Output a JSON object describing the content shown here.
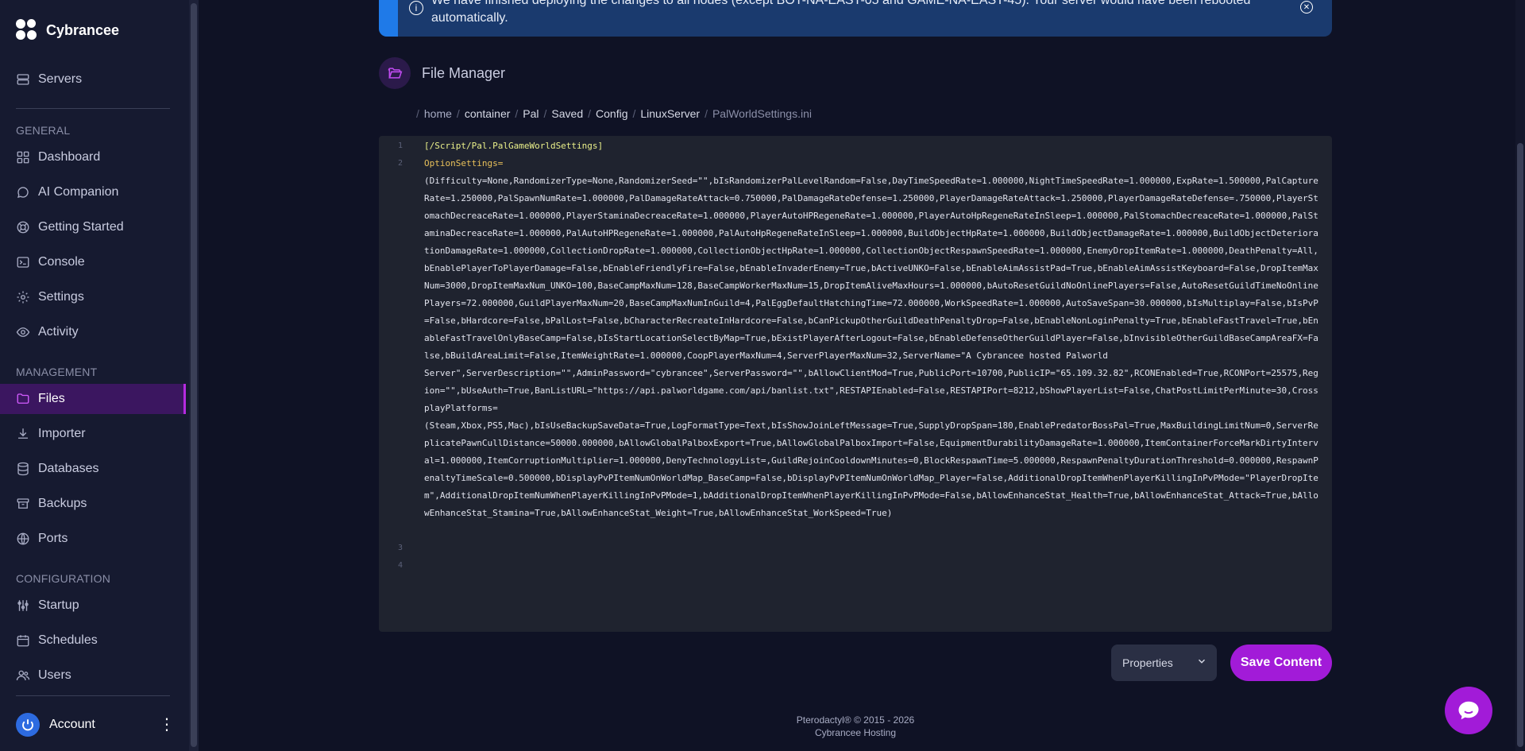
{
  "brand": {
    "name": "Cybrancee"
  },
  "sidebar": {
    "top_item": "Servers",
    "sections": {
      "general": "GENERAL",
      "management": "MANAGEMENT",
      "configuration": "CONFIGURATION"
    },
    "items": {
      "dashboard": "Dashboard",
      "ai_companion": "AI Companion",
      "getting_started": "Getting Started",
      "console": "Console",
      "settings": "Settings",
      "activity": "Activity",
      "files": "Files",
      "importer": "Importer",
      "databases": "Databases",
      "backups": "Backups",
      "ports": "Ports",
      "startup": "Startup",
      "schedules": "Schedules",
      "users": "Users"
    },
    "account": "Account"
  },
  "alert": {
    "text": "We have finished deploying the changes to all nodes (except BOT-NA-EAST-05 and GAME-NA-EAST-45). Your server would have been rebooted automatically."
  },
  "file_manager": {
    "title": "File Manager"
  },
  "breadcrumb": {
    "segments": [
      "home",
      "container",
      "Pal",
      "Saved",
      "Config",
      "LinuxServer"
    ],
    "file": "PalWorldSettings.ini"
  },
  "editor": {
    "line_numbers": [
      "1",
      "2",
      "3",
      "4"
    ],
    "line1": "[/Script/Pal.PalGameWorldSettings]",
    "line2": "OptionSettings=",
    "content": "(Difficulty=None,RandomizerType=None,RandomizerSeed=\"\",bIsRandomizerPalLevelRandom=False,DayTimeSpeedRate=1.000000,NightTimeSpeedRate=1.000000,ExpRate=1.500000,PalCaptureRate=1.250000,PalSpawnNumRate=1.000000,PalDamageRateAttack=0.750000,PalDamageRateDefense=1.250000,PlayerDamageRateAttack=1.250000,PlayerDamageRateDefense=.750000,PlayerStomachDecreaceRate=1.000000,PlayerStaminaDecreaceRate=1.000000,PlayerAutoHPRegeneRate=1.000000,PlayerAutoHpRegeneRateInSleep=1.000000,PalStomachDecreaceRate=1.000000,PalStaminaDecreaceRate=1.000000,PalAutoHPRegeneRate=1.000000,PalAutoHpRegeneRateInSleep=1.000000,BuildObjectHpRate=1.000000,BuildObjectDamageRate=1.000000,BuildObjectDeteriorationDamageRate=1.000000,CollectionDropRate=1.000000,CollectionObjectHpRate=1.000000,CollectionObjectRespawnSpeedRate=1.000000,EnemyDropItemRate=1.000000,DeathPenalty=All,bEnablePlayerToPlayerDamage=False,bEnableFriendlyFire=False,bEnableInvaderEnemy=True,bActiveUNKO=False,bEnableAimAssistPad=True,bEnableAimAssistKeyboard=False,DropItemMaxNum=3000,DropItemMaxNum_UNKO=100,BaseCampMaxNum=128,BaseCampWorkerMaxNum=15,DropItemAliveMaxHours=1.000000,bAutoResetGuildNoOnlinePlayers=False,AutoResetGuildTimeNoOnlinePlayers=72.000000,GuildPlayerMaxNum=20,BaseCampMaxNumInGuild=4,PalEggDefaultHatchingTime=72.000000,WorkSpeedRate=1.000000,AutoSaveSpan=30.000000,bIsMultiplay=False,bIsPvP=False,bHardcore=False,bPalLost=False,bCharacterRecreateInHardcore=False,bCanPickupOtherGuildDeathPenaltyDrop=False,bEnableNonLoginPenalty=True,bEnableFastTravel=True,bEnableFastTravelOnlyBaseCamp=False,bIsStartLocationSelectByMap=True,bExistPlayerAfterLogout=False,bEnableDefenseOtherGuildPlayer=False,bInvisibleOtherGuildBaseCampAreaFX=False,bBuildAreaLimit=False,ItemWeightRate=1.000000,CoopPlayerMaxNum=4,ServerPlayerMaxNum=32,ServerName=\"A Cybrancee hosted Palworld\nServer\",ServerDescription=\"\",AdminPassword=\"cybrancee\",ServerPassword=\"\",bAllowClientMod=True,PublicPort=10700,PublicIP=\"65.109.32.82\",RCONEnabled=True,RCONPort=25575,Region=\"\",bUseAuth=True,BanListURL=\"https://api.palworldgame.com/api/banlist.txt\",RESTAPIEnabled=False,RESTAPIPort=8212,bShowPlayerList=False,ChatPostLimitPerMinute=30,CrossplayPlatforms=\n(Steam,Xbox,PS5,Mac),bIsUseBackupSaveData=True,LogFormatType=Text,bIsShowJoinLeftMessage=True,SupplyDropSpan=180,EnablePredatorBossPal=True,MaxBuildingLimitNum=0,ServerReplicatePawnCullDistance=50000.000000,bAllowGlobalPalboxExport=True,bAllowGlobalPalboxImport=False,EquipmentDurabilityDamageRate=1.000000,ItemContainerForceMarkDirtyInterval=1.000000,ItemCorruptionMultiplier=1.000000,DenyTechnologyList=,GuildRejoinCooldownMinutes=0,BlockRespawnTime=5.000000,RespawnPenaltyDurationThreshold=0.000000,RespawnPenaltyTimeScale=0.500000,bDisplayPvPItemNumOnWorldMap_BaseCamp=False,bDisplayPvPItemNumOnWorldMap_Player=False,AdditionalDropItemWhenPlayerKillingInPvPMode=\"PlayerDropItem\",AdditionalDropItemNumWhenPlayerKillingInPvPMode=1,bAdditionalDropItemWhenPlayerKillingInPvPMode=False,bAllowEnhanceStat_Health=True,bAllowEnhanceStat_Attack=True,bAllowEnhanceStat_Stamina=True,bAllowEnhanceStat_Weight=True,bAllowEnhanceStat_WorkSpeed=True)"
  },
  "actions": {
    "select_value": "Properties",
    "save_label": "Save Content"
  },
  "footer": {
    "line1": "Pterodactyl® © 2015 - 2026",
    "line2": "Cybrancee Hosting"
  },
  "colors": {
    "accent": "#a21bd8",
    "sidebar_bg": "#161a30",
    "page_bg": "#0f1225",
    "alert_bg": "#1a3a6e"
  }
}
